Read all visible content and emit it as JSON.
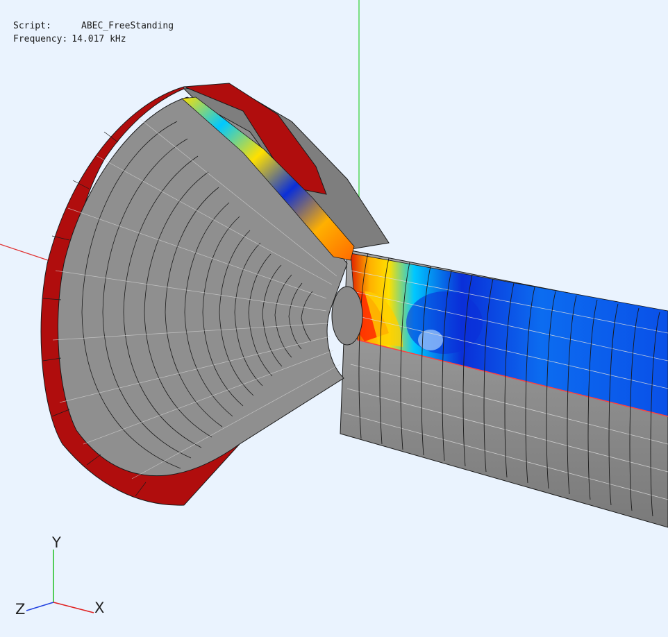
{
  "info": {
    "script_label": "Script:",
    "script_value": "ABEC_FreeStanding",
    "frequency_label": "Frequency:",
    "frequency_value": "14.017 kHz"
  },
  "gizmo": {
    "x_label": "X",
    "y_label": "Y",
    "z_label": "Z",
    "x_color": "#e02020",
    "y_color": "#20c020",
    "z_color": "#2040e0"
  },
  "colors": {
    "background": "#eaf3fe",
    "mesh_surface": "#8e8e8e",
    "mesh_lines": "#1a1a1a",
    "rim": "#b00d0d",
    "field_low": "#0a2fd8",
    "field_mid": "#00c8ff",
    "field_high": "#ffe000",
    "field_peak": "#e02000"
  }
}
